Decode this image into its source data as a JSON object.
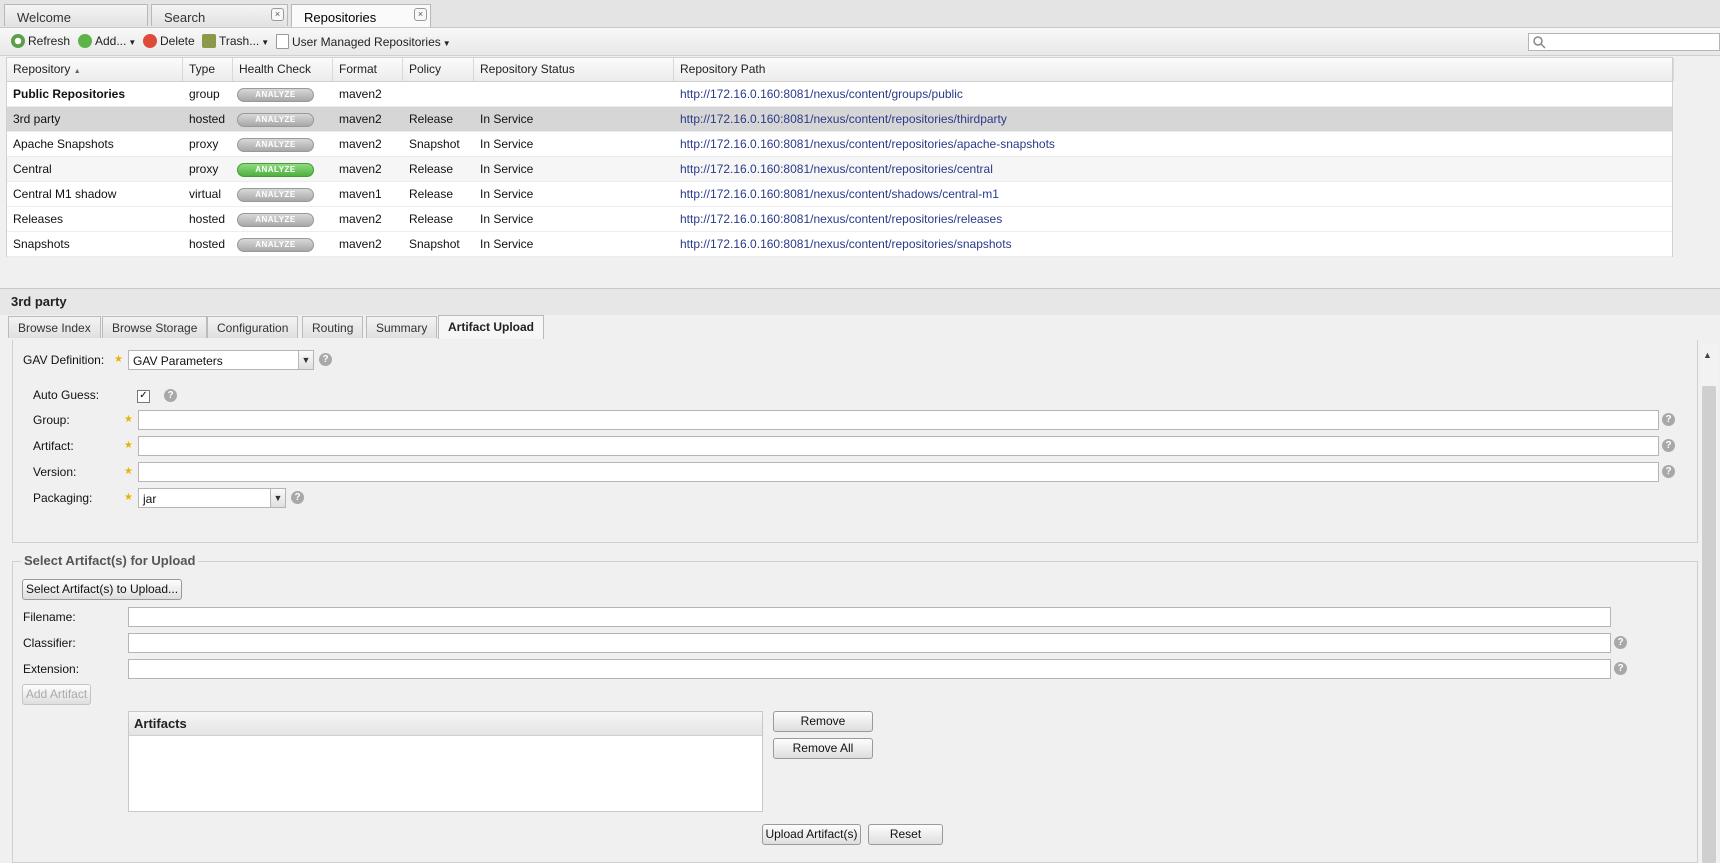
{
  "tabs": [
    {
      "label": "Welcome",
      "closable": false
    },
    {
      "label": "Search",
      "closable": true
    },
    {
      "label": "Repositories",
      "closable": true,
      "active": true
    }
  ],
  "toolbar": {
    "refresh": "Refresh",
    "add": "Add...",
    "delete": "Delete",
    "trash": "Trash...",
    "user_managed": "User Managed Repositories"
  },
  "grid": {
    "columns": [
      "Repository",
      "Type",
      "Health Check",
      "Format",
      "Policy",
      "Repository Status",
      "Repository Path"
    ],
    "sort_indicator": "▲",
    "rows": [
      {
        "name": "Public Repositories",
        "type": "group",
        "health": "ANALYZE",
        "format": "maven2",
        "policy": "",
        "status": "",
        "path": "http://172.16.0.160:8081/nexus/content/groups/public"
      },
      {
        "name": "3rd party",
        "type": "hosted",
        "health": "ANALYZE",
        "format": "maven2",
        "policy": "Release",
        "status": "In Service",
        "path": "http://172.16.0.160:8081/nexus/content/repositories/thirdparty"
      },
      {
        "name": "Apache Snapshots",
        "type": "proxy",
        "health": "ANALYZE",
        "format": "maven2",
        "policy": "Snapshot",
        "status": "In Service",
        "path": "http://172.16.0.160:8081/nexus/content/repositories/apache-snapshots"
      },
      {
        "name": "Central",
        "type": "proxy",
        "health": "ANALYZE",
        "format": "maven2",
        "policy": "Release",
        "status": "In Service",
        "path": "http://172.16.0.160:8081/nexus/content/repositories/central"
      },
      {
        "name": "Central M1 shadow",
        "type": "virtual",
        "health": "ANALYZE",
        "format": "maven1",
        "policy": "Release",
        "status": "In Service",
        "path": "http://172.16.0.160:8081/nexus/content/shadows/central-m1"
      },
      {
        "name": "Releases",
        "type": "hosted",
        "health": "ANALYZE",
        "format": "maven2",
        "policy": "Release",
        "status": "In Service",
        "path": "http://172.16.0.160:8081/nexus/content/repositories/releases"
      },
      {
        "name": "Snapshots",
        "type": "hosted",
        "health": "ANALYZE",
        "format": "maven2",
        "policy": "Snapshot",
        "status": "In Service",
        "path": "http://172.16.0.160:8081/nexus/content/repositories/snapshots"
      }
    ]
  },
  "detail": {
    "title": "3rd party",
    "tabs": [
      "Browse Index",
      "Browse Storage",
      "Configuration",
      "Routing",
      "Summary",
      "Artifact Upload"
    ],
    "gav": {
      "definition_label": "GAV Definition:",
      "definition_value": "GAV Parameters",
      "auto_guess_label": "Auto Guess:",
      "group_label": "Group:",
      "artifact_label": "Artifact:",
      "version_label": "Version:",
      "packaging_label": "Packaging:",
      "packaging_value": "jar"
    },
    "upload": {
      "legend": "Select Artifact(s) for Upload",
      "select_button": "Select Artifact(s) to Upload...",
      "filename_label": "Filename:",
      "classifier_label": "Classifier:",
      "extension_label": "Extension:",
      "add_button": "Add Artifact",
      "artifacts_header": "Artifacts",
      "remove_button": "Remove",
      "remove_all_button": "Remove All",
      "upload_button": "Upload Artifact(s)",
      "reset_button": "Reset"
    }
  },
  "colors": {
    "health_green": "#4fb03e",
    "link": "#2a3a8a",
    "selected_row": "#d6d6d6"
  }
}
